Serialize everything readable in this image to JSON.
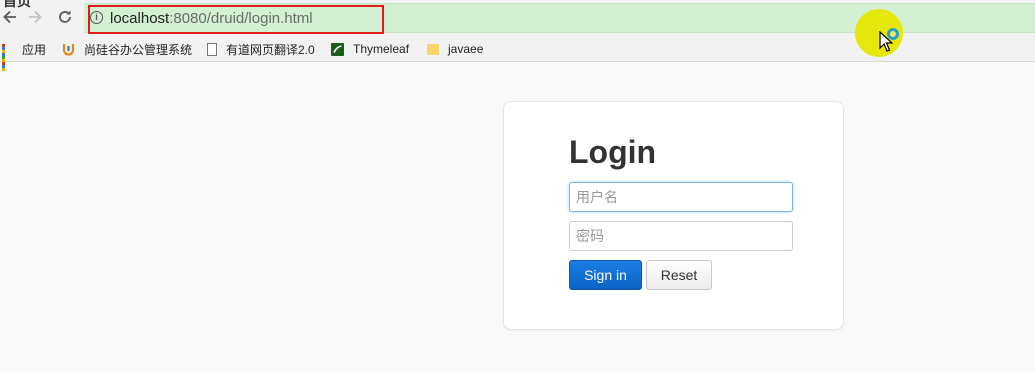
{
  "browser": {
    "clipped_glyph": "首页",
    "url_host": "localhost",
    "url_rest": ":8080/druid/login.html",
    "accent_highlight": "#e11b1b",
    "omnibox_color": "#d3f0d3"
  },
  "bookmarks": [
    {
      "label": "应用",
      "icon": "apps-grid-icon"
    },
    {
      "label": "尚硅谷办公管理系统",
      "icon": "site-logo-icon"
    },
    {
      "label": "有道网页翻译2.0",
      "icon": "page-icon"
    },
    {
      "label": "Thymeleaf",
      "icon": "thymeleaf-icon"
    },
    {
      "label": "javaee",
      "icon": "folder-icon"
    }
  ],
  "login": {
    "title": "Login",
    "username_placeholder": "用户名",
    "password_placeholder": "密码",
    "signin_label": "Sign in",
    "reset_label": "Reset"
  }
}
